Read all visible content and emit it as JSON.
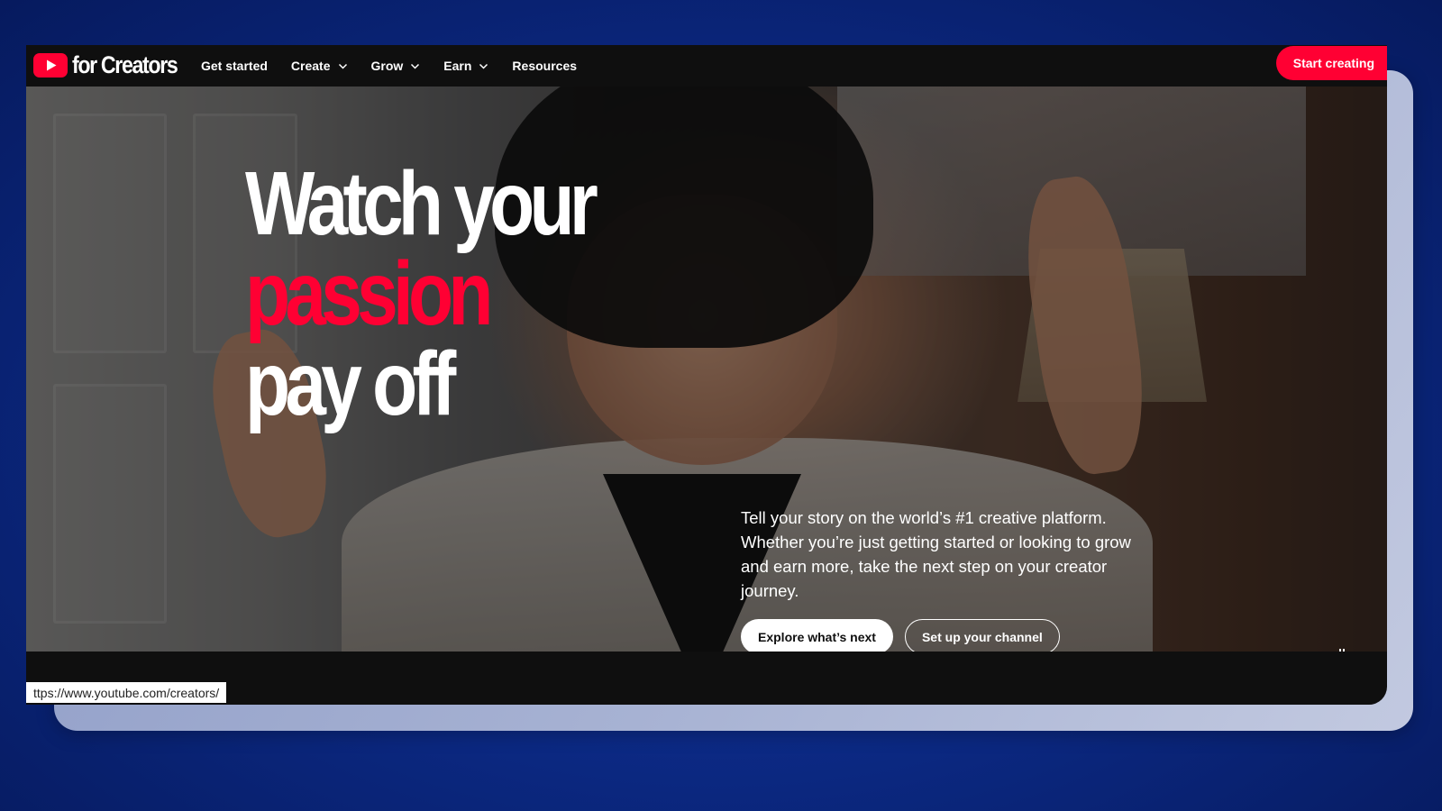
{
  "brand": {
    "logo_text": "for Creators",
    "accent_color": "#ff0033"
  },
  "nav": {
    "items": [
      {
        "label": "Get started",
        "has_dropdown": false
      },
      {
        "label": "Create",
        "has_dropdown": true
      },
      {
        "label": "Grow",
        "has_dropdown": true
      },
      {
        "label": "Earn",
        "has_dropdown": true
      },
      {
        "label": "Resources",
        "has_dropdown": false
      }
    ],
    "cta_label": "Start creating"
  },
  "hero": {
    "headline_line1": "Watch your",
    "headline_line2": "passion",
    "headline_line3": "pay off",
    "description": "Tell your story on the world’s #1 creative platform. Whether you’re just getting started or looking to grow and earn more, take the next step on your creator journey.",
    "primary_button": "Explore what’s next",
    "secondary_button": "Set up your channel",
    "video_control_icon": "pause-icon"
  },
  "status_bar": {
    "url": "ttps://www.youtube.com/creators/"
  }
}
